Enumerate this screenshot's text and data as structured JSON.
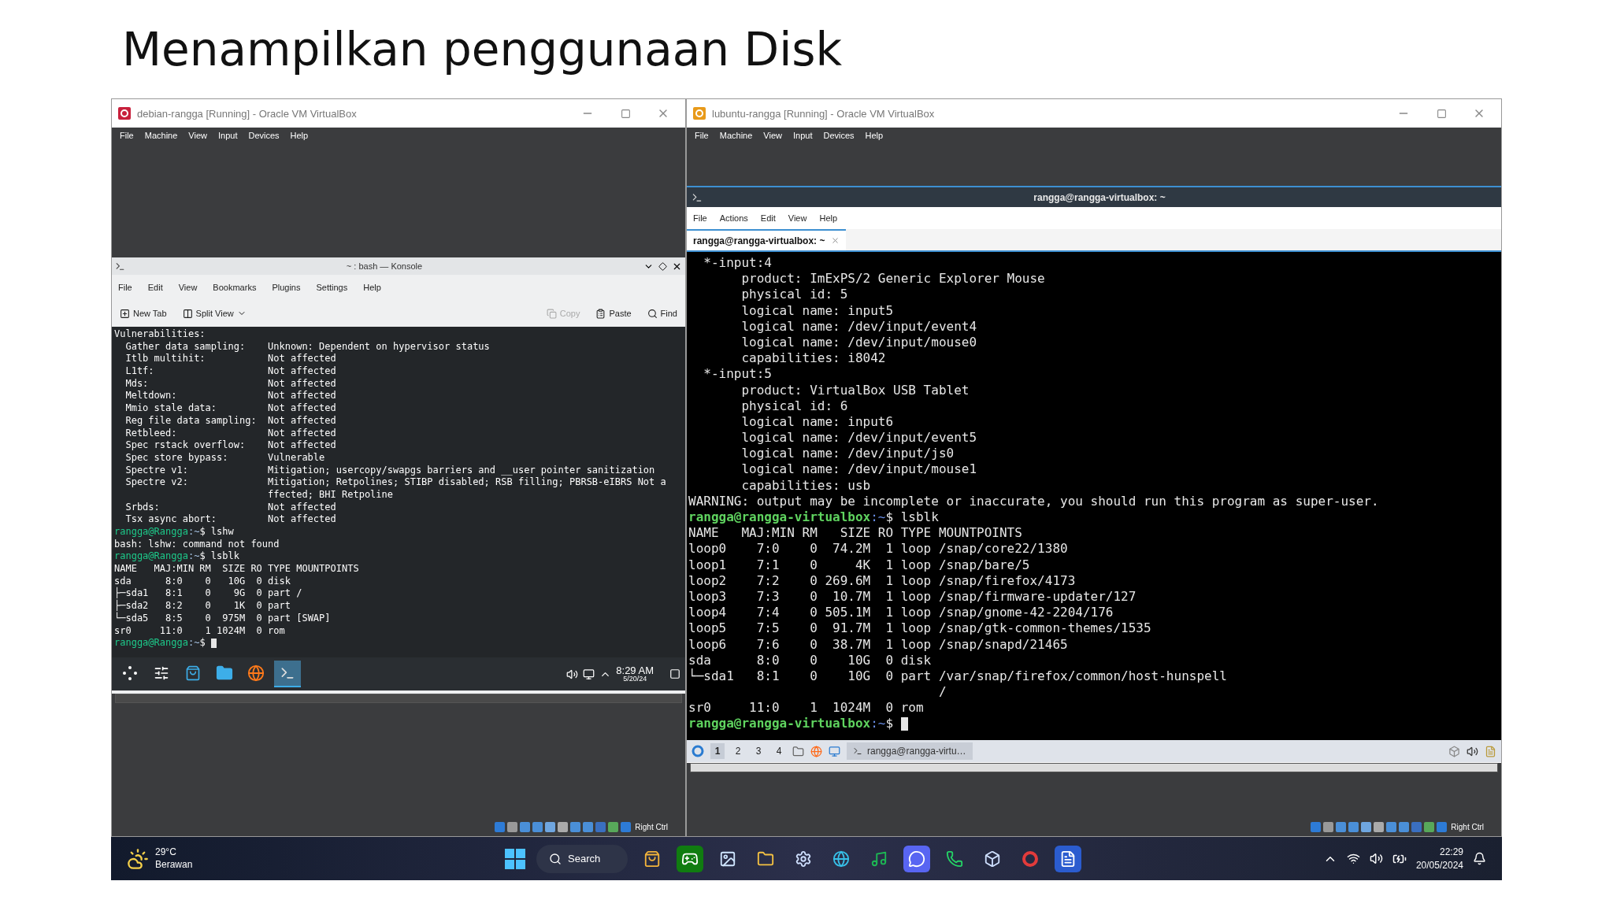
{
  "slide_title": "Menampilkan penggunaan Disk",
  "windows": [
    {
      "title": "debian-rangga [Running] - Oracle VM VirtualBox",
      "menu": [
        "File",
        "Machine",
        "View",
        "Input",
        "Devices",
        "Help"
      ],
      "guest": {
        "kind": "konsole",
        "title": "~ : bash — Konsole",
        "menu": [
          "File",
          "Edit",
          "View",
          "Bookmarks",
          "Plugins",
          "Settings",
          "Help"
        ],
        "toolbar": [
          {
            "label": "New Tab",
            "disabled": false
          },
          {
            "label": "Split View",
            "disabled": false
          },
          {
            "label": "Copy",
            "disabled": true
          },
          {
            "label": "Paste",
            "disabled": false
          },
          {
            "label": "Find",
            "disabled": false
          }
        ],
        "lines": [
          {
            "kind": "text",
            "text": "Vulnerabilities:"
          },
          {
            "kind": "pair",
            "label": "Gather data sampling:",
            "value": "Unknown: Dependent on hypervisor status"
          },
          {
            "kind": "pair",
            "label": "Itlb multihit:",
            "value": "Not affected"
          },
          {
            "kind": "pair",
            "label": "L1tf:",
            "value": "Not affected"
          },
          {
            "kind": "pair",
            "label": "Mds:",
            "value": "Not affected"
          },
          {
            "kind": "pair",
            "label": "Meltdown:",
            "value": "Not affected"
          },
          {
            "kind": "pair",
            "label": "Mmio stale data:",
            "value": "Not affected"
          },
          {
            "kind": "pair",
            "label": "Reg file data sampling:",
            "value": "Not affected"
          },
          {
            "kind": "pair",
            "label": "Retbleed:",
            "value": "Not affected"
          },
          {
            "kind": "pair",
            "label": "Spec rstack overflow:",
            "value": "Not affected"
          },
          {
            "kind": "pair",
            "label": "Spec store bypass:",
            "value": "Vulnerable"
          },
          {
            "kind": "pair",
            "label": "Spectre v1:",
            "value": "Mitigation; usercopy/swapgs barriers and __user pointer sanitization"
          },
          {
            "kind": "pair",
            "label": "Spectre v2:",
            "value": "Mitigation; Retpolines; STIBP disabled; RSB filling; PBRSB-eIBRS Not a"
          },
          {
            "kind": "cont",
            "value": "ffected; BHI Retpoline"
          },
          {
            "kind": "pair",
            "label": "Srbds:",
            "value": "Not affected"
          },
          {
            "kind": "pair",
            "label": "Tsx async abort:",
            "value": "Not affected"
          },
          {
            "kind": "prompt",
            "user": "rangga@Rangga",
            "path": ":~",
            "command": "$ lshw",
            "cursor": false
          },
          {
            "kind": "text",
            "text": "bash: lshw: command not found"
          },
          {
            "kind": "prompt",
            "user": "rangga@Rangga",
            "path": ":~",
            "command": "$ lsblk",
            "cursor": false
          },
          {
            "kind": "text",
            "text": "NAME   MAJ:MIN RM  SIZE RO TYPE MOUNTPOINTS"
          },
          {
            "kind": "text",
            "text": "sda      8:0    0   10G  0 disk"
          },
          {
            "kind": "text",
            "text": "├─sda1   8:1    0    9G  0 part /"
          },
          {
            "kind": "text",
            "text": "├─sda2   8:2    0    1K  0 part"
          },
          {
            "kind": "text",
            "text": "└─sda5   8:5    0  975M  0 part [SWAP]"
          },
          {
            "kind": "text",
            "text": "sr0     11:0    1 1024M  0 rom"
          },
          {
            "kind": "prompt",
            "user": "rangga@Rangga",
            "path": ":~",
            "command": "$",
            "cursor": true
          }
        ],
        "panel": {
          "launchers": [
            {
              "active": false
            },
            {
              "active": false
            },
            {
              "active": false
            },
            {
              "active": false
            },
            {
              "active": false
            },
            {
              "active": true
            }
          ],
          "time": "8:29 AM",
          "date": "5/20/24"
        }
      },
      "status": "Right Ctrl"
    },
    {
      "title": "lubuntu-rangga [Running] - Oracle VM VirtualBox",
      "menu": [
        "File",
        "Machine",
        "View",
        "Input",
        "Devices",
        "Help"
      ],
      "guest": {
        "kind": "qterminal",
        "title": "rangga@rangga-virtualbox: ~",
        "menu": [
          "File",
          "Actions",
          "Edit",
          "View",
          "Help"
        ],
        "tabs": [
          {
            "label": "rangga@rangga-virtualbox: ~",
            "selected": true
          }
        ],
        "lines": [
          {
            "kind": "text",
            "text": "  *-input:4"
          },
          {
            "kind": "text",
            "text": "       product: ImExPS/2 Generic Explorer Mouse"
          },
          {
            "kind": "text",
            "text": "       physical id: 5"
          },
          {
            "kind": "text",
            "text": "       logical name: input5"
          },
          {
            "kind": "text",
            "text": "       logical name: /dev/input/event4"
          },
          {
            "kind": "text",
            "text": "       logical name: /dev/input/mouse0"
          },
          {
            "kind": "text",
            "text": "       capabilities: i8042"
          },
          {
            "kind": "text",
            "text": "  *-input:5"
          },
          {
            "kind": "text",
            "text": "       product: VirtualBox USB Tablet"
          },
          {
            "kind": "text",
            "text": "       physical id: 6"
          },
          {
            "kind": "text",
            "text": "       logical name: input6"
          },
          {
            "kind": "text",
            "text": "       logical name: /dev/input/event5"
          },
          {
            "kind": "text",
            "text": "       logical name: /dev/input/js0"
          },
          {
            "kind": "text",
            "text": "       logical name: /dev/input/mouse1"
          },
          {
            "kind": "text",
            "text": "       capabilities: usb"
          },
          {
            "kind": "text",
            "text": "WARNING: output may be incomplete or inaccurate, you should run this program as super-user."
          },
          {
            "kind": "prompt",
            "user": "rangga@rangga-virtualbox",
            "path": ":~",
            "command": "$ lsblk",
            "cursor": false
          },
          {
            "kind": "text",
            "text": "NAME   MAJ:MIN RM   SIZE RO TYPE MOUNTPOINTS"
          },
          {
            "kind": "text",
            "text": "loop0    7:0    0  74.2M  1 loop /snap/core22/1380"
          },
          {
            "kind": "text",
            "text": "loop1    7:1    0     4K  1 loop /snap/bare/5"
          },
          {
            "kind": "text",
            "text": "loop2    7:2    0 269.6M  1 loop /snap/firefox/4173"
          },
          {
            "kind": "text",
            "text": "loop3    7:3    0  10.7M  1 loop /snap/firmware-updater/127"
          },
          {
            "kind": "text",
            "text": "loop4    7:4    0 505.1M  1 loop /snap/gnome-42-2204/176"
          },
          {
            "kind": "text",
            "text": "loop5    7:5    0  91.7M  1 loop /snap/gtk-common-themes/1535"
          },
          {
            "kind": "text",
            "text": "loop6    7:6    0  38.7M  1 loop /snap/snapd/21465"
          },
          {
            "kind": "text",
            "text": "sda      8:0    0    10G  0 disk"
          },
          {
            "kind": "text",
            "text": "└─sda1   8:1    0    10G  0 part /var/snap/firefox/common/host-hunspell"
          },
          {
            "kind": "text",
            "text": "                                 /"
          },
          {
            "kind": "text",
            "text": "sr0     11:0    1  1024M  0 rom"
          },
          {
            "kind": "prompt",
            "user": "rangga@rangga-virtualbox",
            "path": ":~",
            "command": "$",
            "cursor": true
          }
        ],
        "panel": {
          "workspaces": [
            {
              "label": "1",
              "selected": true
            },
            {
              "label": "2",
              "selected": false
            },
            {
              "label": "3",
              "selected": false
            },
            {
              "label": "4",
              "selected": false
            }
          ],
          "task": "rangga@rangga-virtu…"
        }
      },
      "status": "Right Ctrl"
    }
  ],
  "taskbar": {
    "temperature": "29°C",
    "weather": "Berawan",
    "search": "Search",
    "time": "22:29",
    "date": "20/05/2024"
  }
}
